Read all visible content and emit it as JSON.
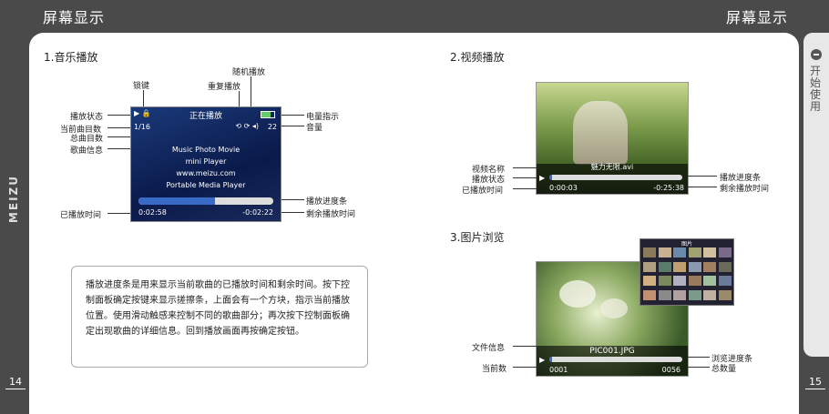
{
  "header": {
    "left_title": "屏幕显示",
    "right_title": "屏幕显示"
  },
  "side_tab": {
    "text": "开始使用"
  },
  "brand": {
    "logo": "MEIZU"
  },
  "page_numbers": {
    "left": "14",
    "right": "15"
  },
  "music": {
    "section_title": "1.音乐播放",
    "labels": {
      "shuffle": "随机播放",
      "lock": "锁键",
      "repeat": "重复播放",
      "play_state": "播放状态",
      "current_track": "当前曲目数",
      "total_tracks": "总曲目数",
      "song_info": "歌曲信息",
      "battery": "电量指示",
      "volume": "音量",
      "progress_bar": "播放进度条",
      "remaining_time": "剩余播放时间",
      "elapsed_time": "已播放时间"
    },
    "screen": {
      "title": "正在播放",
      "track_counter": "1/16",
      "volume_value": "22",
      "info_lines": [
        "Music Photo Movie",
        "mini Player",
        "www.meizu.com",
        "Portable Media Player"
      ],
      "elapsed": "0:02:58",
      "remaining": "-0:02:22",
      "progress_fraction": 0.57
    },
    "description": "播放进度条是用来显示当前歌曲的已播放时间和剩余时间。按下控制面板确定按键来显示搓擦条，上面会有一个方块，指示当前播放位置。使用滑动触感来控制不同的歌曲部分；再次按下控制面板确定出现歌曲的详细信息。回到播放画面再按确定按钮。"
  },
  "video": {
    "section_title": "2.视频播放",
    "labels": {
      "video_name": "视频名称",
      "play_state": "播放状态",
      "elapsed_time": "已播放时间",
      "progress_bar": "播放进度条",
      "remaining_time": "剩余播放时间"
    },
    "screen": {
      "file_name": "魅力无限.avi",
      "elapsed": "0:00:03",
      "remaining": "-0:25:38",
      "progress_fraction": 0.02
    }
  },
  "photo": {
    "section_title": "3.图片浏览",
    "labels": {
      "file_info": "文件信息",
      "current_number": "当前数",
      "progress_bar": "浏览进度条",
      "total": "总数量"
    },
    "screen": {
      "file_name": "PIC001.JPG",
      "current": "0001",
      "total": "0056",
      "grid_title": "图片",
      "progress_fraction": 0.02
    }
  }
}
